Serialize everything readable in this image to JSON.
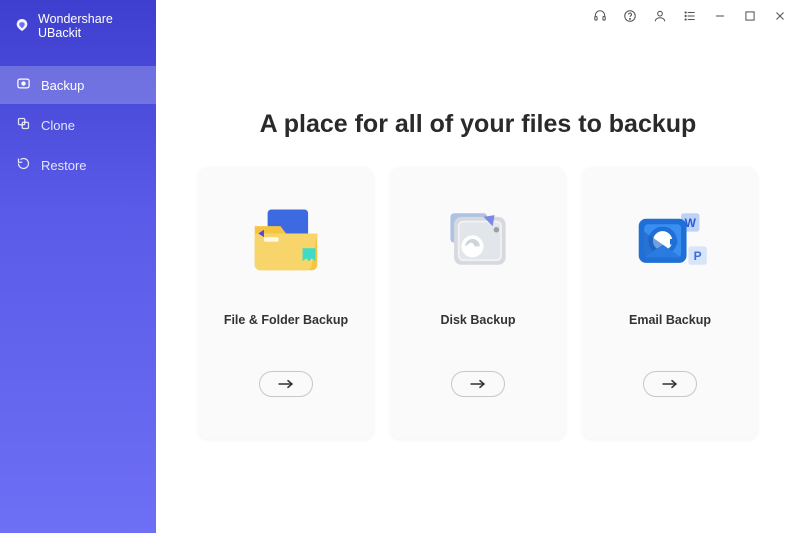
{
  "app": {
    "name": "Wondershare UBackit"
  },
  "sidebar": {
    "items": [
      {
        "label": "Backup",
        "icon": "backup-icon",
        "active": true
      },
      {
        "label": "Clone",
        "icon": "clone-icon",
        "active": false
      },
      {
        "label": "Restore",
        "icon": "restore-icon",
        "active": false
      }
    ]
  },
  "titlebar_icons": [
    "headset-icon",
    "help-icon",
    "user-icon",
    "list-icon",
    "minimize-icon",
    "maximize-icon",
    "close-icon"
  ],
  "main": {
    "headline": "A place for all of your files to backup",
    "cards": [
      {
        "label": "File & Folder Backup",
        "icon": "folder-illustration"
      },
      {
        "label": "Disk Backup",
        "icon": "disk-illustration"
      },
      {
        "label": "Email Backup",
        "icon": "email-illustration"
      }
    ]
  }
}
